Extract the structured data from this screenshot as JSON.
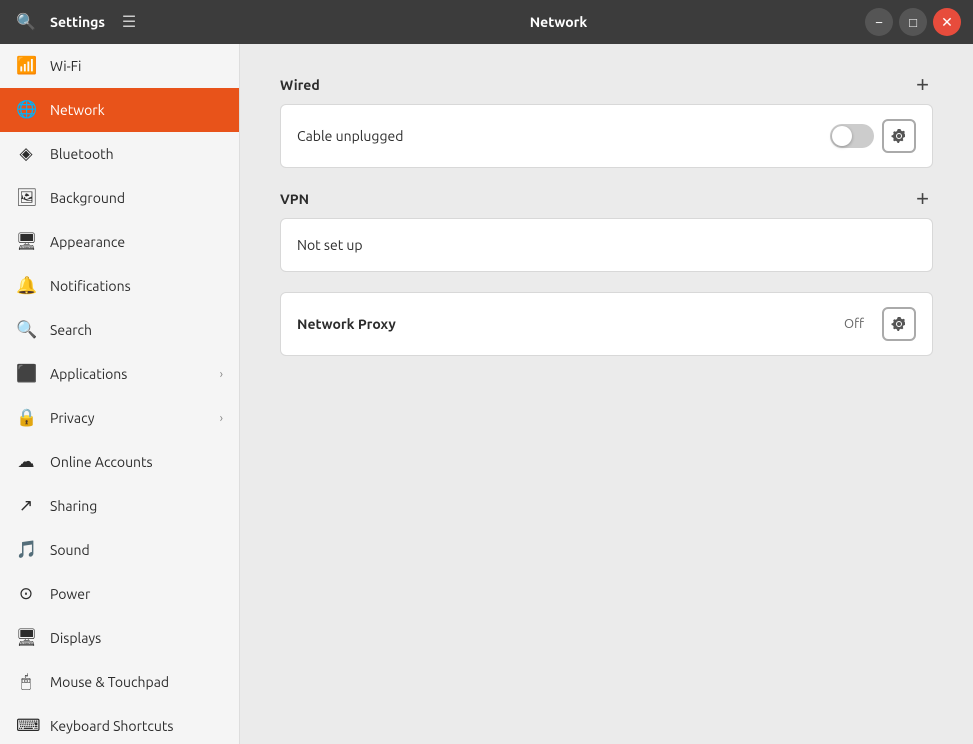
{
  "titlebar": {
    "app_title": "Settings",
    "page_title": "Network",
    "btn_minimize": "−",
    "btn_maximize": "□",
    "btn_close": "✕"
  },
  "sidebar": {
    "items": [
      {
        "id": "wifi",
        "label": "Wi-Fi",
        "icon": "📶",
        "has_chevron": false,
        "active": false
      },
      {
        "id": "network",
        "label": "Network",
        "icon": "🌐",
        "has_chevron": false,
        "active": true
      },
      {
        "id": "bluetooth",
        "label": "Bluetooth",
        "icon": "🔷",
        "has_chevron": false,
        "active": false
      },
      {
        "id": "background",
        "label": "Background",
        "icon": "🖼",
        "has_chevron": false,
        "active": false
      },
      {
        "id": "appearance",
        "label": "Appearance",
        "icon": "🖥",
        "has_chevron": false,
        "active": false
      },
      {
        "id": "notifications",
        "label": "Notifications",
        "icon": "🔔",
        "has_chevron": false,
        "active": false
      },
      {
        "id": "search",
        "label": "Search",
        "icon": "🔍",
        "has_chevron": false,
        "active": false
      },
      {
        "id": "applications",
        "label": "Applications",
        "icon": "📦",
        "has_chevron": true,
        "active": false
      },
      {
        "id": "privacy",
        "label": "Privacy",
        "icon": "🔒",
        "has_chevron": true,
        "active": false
      },
      {
        "id": "online-accounts",
        "label": "Online Accounts",
        "icon": "☁",
        "has_chevron": false,
        "active": false
      },
      {
        "id": "sharing",
        "label": "Sharing",
        "icon": "↗",
        "has_chevron": false,
        "active": false
      },
      {
        "id": "sound",
        "label": "Sound",
        "icon": "🎵",
        "has_chevron": false,
        "active": false
      },
      {
        "id": "power",
        "label": "Power",
        "icon": "⊙",
        "has_chevron": false,
        "active": false
      },
      {
        "id": "displays",
        "label": "Displays",
        "icon": "🖥",
        "has_chevron": false,
        "active": false
      },
      {
        "id": "mouse-touchpad",
        "label": "Mouse & Touchpad",
        "icon": "🖱",
        "has_chevron": false,
        "active": false
      },
      {
        "id": "keyboard-shortcuts",
        "label": "Keyboard Shortcuts",
        "icon": "⌨",
        "has_chevron": false,
        "active": false
      }
    ]
  },
  "content": {
    "wired_section": {
      "title": "Wired",
      "add_button": "+",
      "cable_status": "Cable unplugged",
      "toggle_on": false
    },
    "vpn_section": {
      "title": "VPN",
      "add_button": "+",
      "not_set_up": "Not set up"
    },
    "proxy_section": {
      "title": "Network Proxy",
      "status": "Off"
    }
  }
}
